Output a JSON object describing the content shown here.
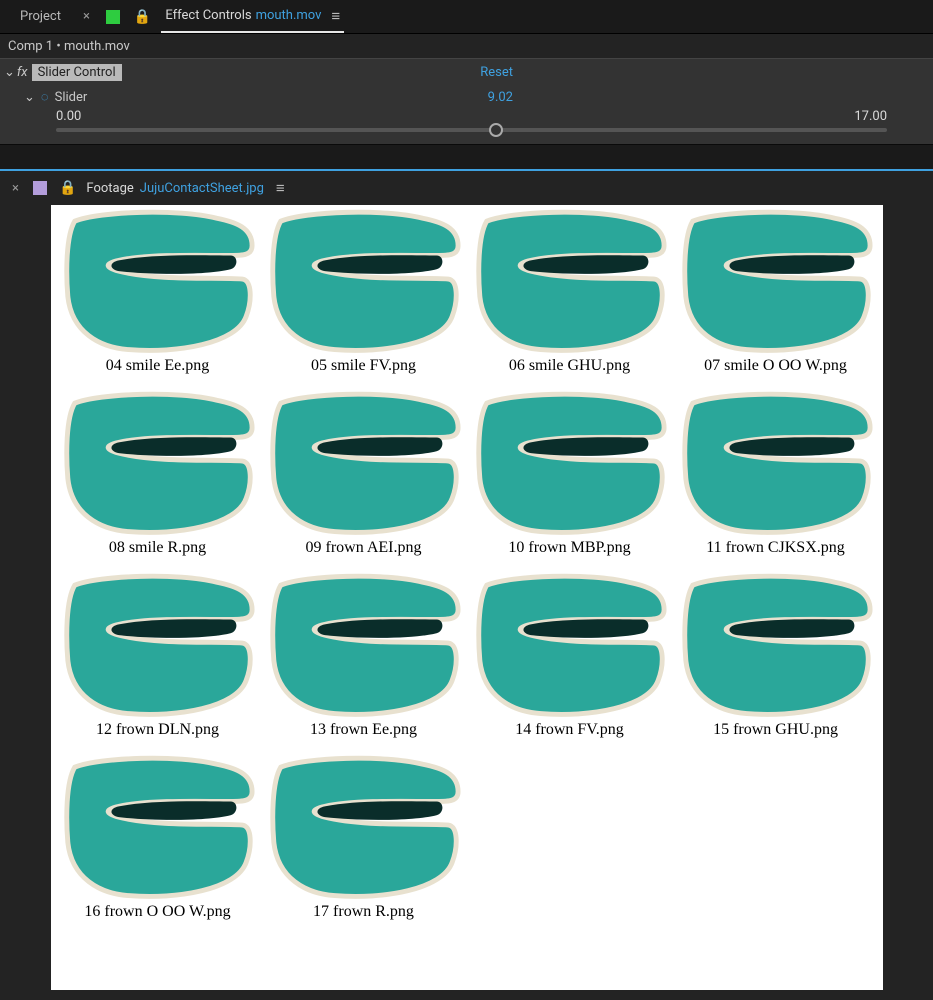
{
  "top_tabs": {
    "project_label": "Project",
    "effect_controls_label": "Effect Controls",
    "effect_controls_filename": "mouth.mov"
  },
  "crumb": "Comp 1 • mouth.mov",
  "effect": {
    "name": "Slider Control",
    "reset_label": "Reset",
    "param_label": "Slider",
    "param_value": "9.02",
    "range_min": "0.00",
    "range_max": "17.00"
  },
  "footage_tab": {
    "prefix": "Footage",
    "filename": "JujuContactSheet.jpg"
  },
  "contact_sheet": {
    "items": [
      "04 smile Ee.png",
      "05 smile FV.png",
      "06 smile GHU.png",
      "07 smile O OO W.png",
      "08 smile R.png",
      "09 frown AEI.png",
      "10 frown MBP.png",
      "11 frown CJKSX.png",
      "12 frown DLN.png",
      "13 frown Ee.png",
      "14 frown FV.png",
      "15 frown GHU.png",
      "16 frown O OO W.png",
      "17 frown R.png"
    ]
  },
  "colors": {
    "accent_blue": "#3fa1e0",
    "teal": "#2aa79a"
  }
}
